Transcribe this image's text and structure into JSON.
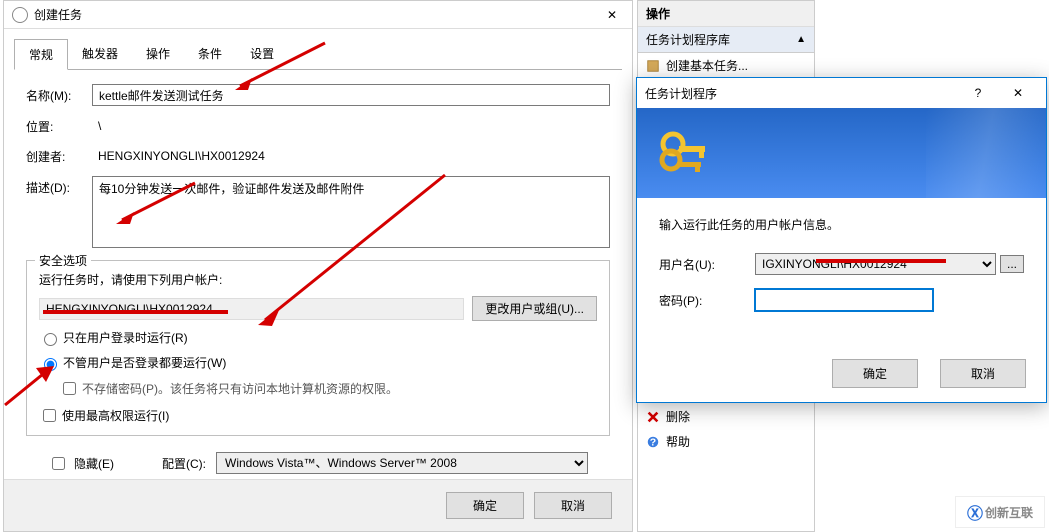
{
  "main": {
    "title": "创建任务",
    "tabs": [
      "常规",
      "触发器",
      "操作",
      "条件",
      "设置"
    ],
    "active_tab": 0,
    "name_label": "名称(M):",
    "name_value": "kettle邮件发送测试任务",
    "location_label": "位置:",
    "location_value": "\\",
    "creator_label": "创建者:",
    "creator_value": "HENGXINYONGLI\\HX0012924",
    "desc_label": "描述(D):",
    "desc_value": "每10分钟发送一次邮件，验证邮件发送及邮件附件",
    "security_group": "安全选项",
    "runas_prompt": "运行任务时，请使用下列用户帐户:",
    "runas_user": "HENGXINYONGLI\\HX0012924",
    "change_user_btn": "更改用户或组(U)...",
    "radio_logged_on": "只在用户登录时运行(R)",
    "radio_always_run": "不管用户是否登录都要运行(W)",
    "no_store_pwd": "不存储密码(P)。该任务将只有访问本地计算机资源的权限。",
    "highest_priv": "使用最高权限运行(I)",
    "hidden": "隐藏(E)",
    "config_label": "配置(C):",
    "config_value": "Windows Vista™、Windows Server™ 2008",
    "ok_btn": "确定",
    "cancel_btn": "取消"
  },
  "actions": {
    "header": "操作",
    "lib": "任务计划程序库",
    "create_basic": "创建基本任务...",
    "delete": "删除",
    "help": "帮助"
  },
  "cred": {
    "title": "任务计划程序",
    "prompt": "输入运行此任务的用户帐户信息。",
    "user_label": "用户名(U):",
    "user_value": "IGXINYONGLI\\HX0012924",
    "pwd_label": "密码(P):",
    "ok_btn": "确定",
    "cancel_btn": "取消",
    "browse_btn": "..."
  },
  "logo_text": "创新互联"
}
